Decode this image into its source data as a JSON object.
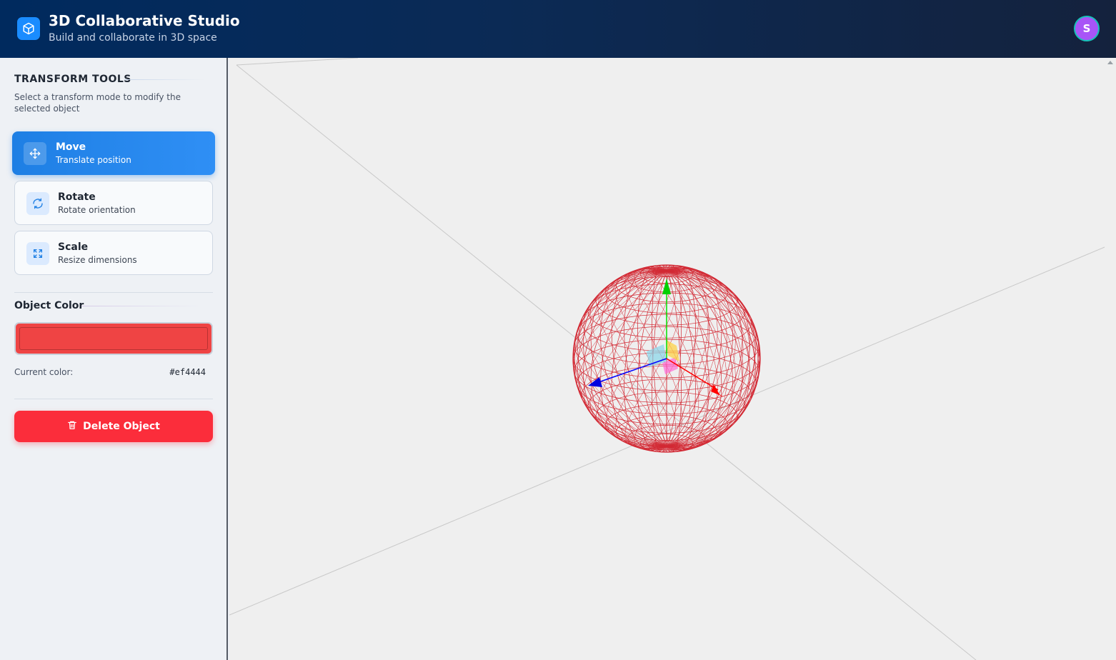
{
  "header": {
    "title": "3D Collaborative Studio",
    "subtitle": "Build and collaborate in 3D space",
    "user_initial": "S",
    "logo_icon": "cube-icon"
  },
  "sidebar": {
    "transform_title": "TRANSFORM TOOLS",
    "transform_desc": "Select a transform mode to modify the selected object",
    "tools": [
      {
        "label": "Move",
        "sub": "Translate position",
        "icon": "move-icon",
        "active": true
      },
      {
        "label": "Rotate",
        "sub": "Rotate orientation",
        "icon": "rotate-icon",
        "active": false
      },
      {
        "label": "Scale",
        "sub": "Resize dimensions",
        "icon": "scale-icon",
        "active": false
      }
    ],
    "color_title": "Object Color",
    "current_color_label": "Current color:",
    "current_color_value": "#ef4444",
    "delete_label": "Delete Object"
  },
  "viewport": {
    "object": "sphere-wireframe",
    "object_color": "#ef4444",
    "gizmo_axes": {
      "x": "#ff0000",
      "y": "#00ff00",
      "z": "#0000ff"
    }
  },
  "colors": {
    "accent": "#1e7fe4",
    "danger": "#fb2d3b",
    "avatar": "#a855f7"
  }
}
